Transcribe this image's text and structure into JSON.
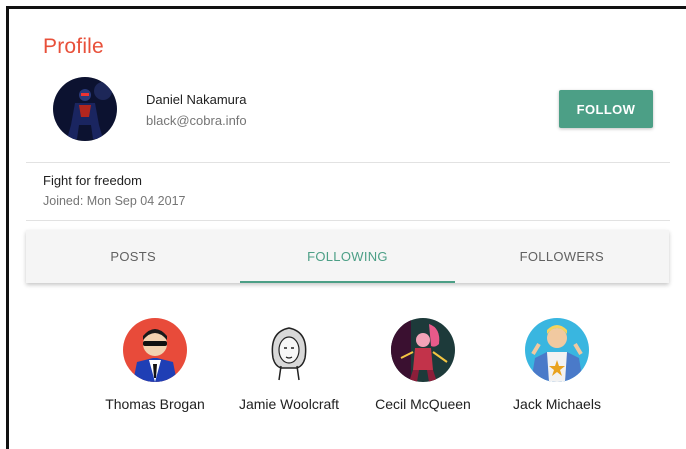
{
  "profile": {
    "title": "Profile",
    "name": "Daniel Nakamura",
    "email": "black@cobra.info",
    "follow_label": "FOLLOW",
    "bio": "Fight for freedom",
    "joined": "Joined: Mon Sep 04 2017"
  },
  "tabs": [
    {
      "label": "POSTS",
      "active": false
    },
    {
      "label": "FOLLOWING",
      "active": true
    },
    {
      "label": "FOLLOWERS",
      "active": false
    }
  ],
  "following": [
    {
      "name": "Thomas Brogan"
    },
    {
      "name": "Jamie Woolcraft"
    },
    {
      "name": "Cecil McQueen"
    },
    {
      "name": "Jack Michaels"
    }
  ],
  "colors": {
    "title": "#e8503a",
    "accent": "#4c9f86"
  }
}
